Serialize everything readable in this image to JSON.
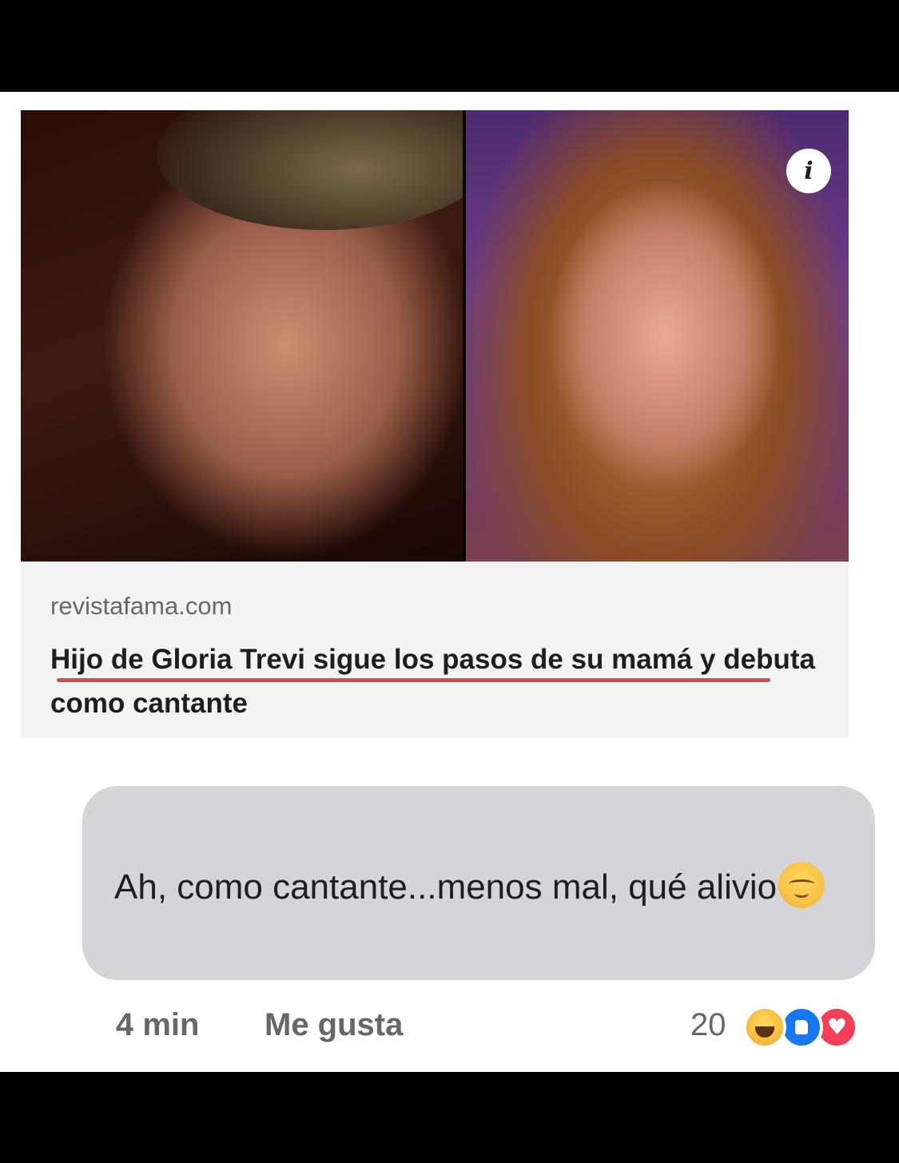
{
  "preview": {
    "info_symbol": "i",
    "source": "revistafama.com",
    "headline": "Hijo de Gloria Trevi sigue los pasos de su mamá y debuta como cantante",
    "underline_color": "#c8534a"
  },
  "comment": {
    "text": "Ah, como cantante...menos mal, qué alivio",
    "emoji": "relieved-face",
    "time": "4 min",
    "like_label": "Me gusta",
    "reaction_count": "20",
    "reactions": [
      "haha-icon",
      "like-icon",
      "love-icon"
    ]
  },
  "colors": {
    "bubble": "#d4d5d9",
    "meta_text": "#65676b",
    "like_blue": "#1877f2",
    "love_red": "#f33e58"
  }
}
